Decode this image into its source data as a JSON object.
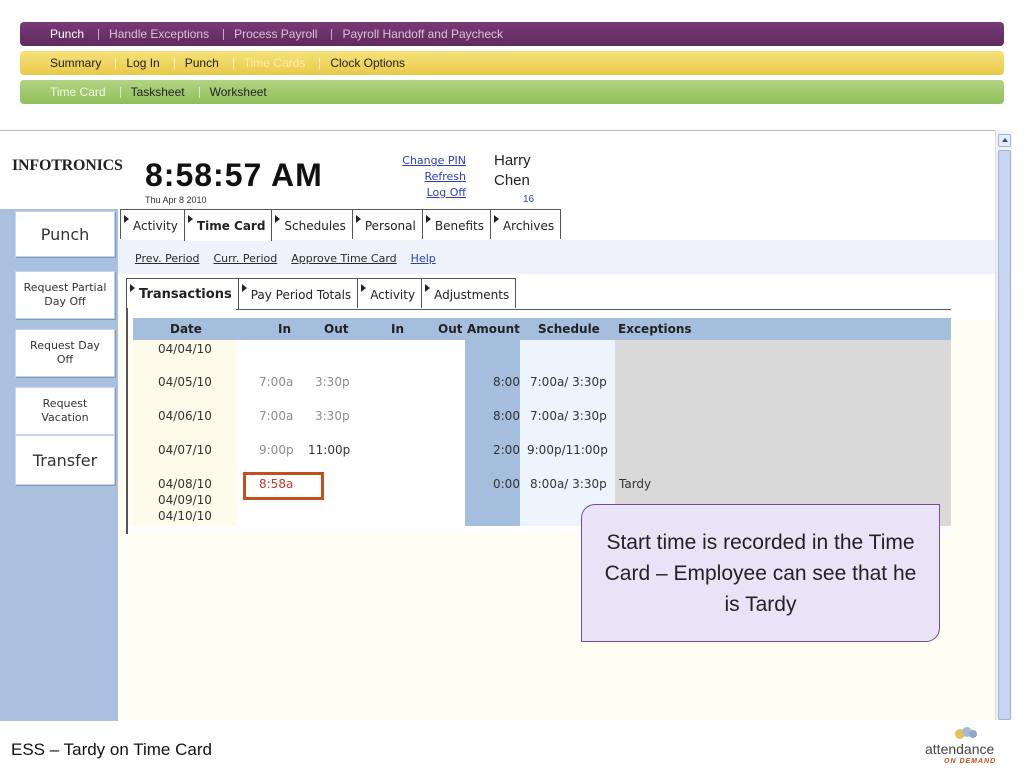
{
  "nav": {
    "level1": [
      {
        "label": "Punch",
        "active": true
      },
      {
        "label": "Handle Exceptions",
        "active": false
      },
      {
        "label": "Process Payroll",
        "active": false
      },
      {
        "label": "Payroll Handoff and Paycheck",
        "active": false
      }
    ],
    "level2": [
      {
        "label": "Summary",
        "active": false
      },
      {
        "label": "Log In",
        "active": false
      },
      {
        "label": "Punch",
        "active": false
      },
      {
        "label": "Time Cards",
        "active": true
      },
      {
        "label": "Clock Options",
        "active": false
      }
    ],
    "level3": [
      {
        "label": "Time Card",
        "active": true
      },
      {
        "label": "Tasksheet",
        "active": false
      },
      {
        "label": "Worksheet",
        "active": false
      }
    ]
  },
  "header": {
    "logo": "INFOTRONICS",
    "clock": "8:58:57 AM",
    "date": "Thu Apr 8 2010",
    "links": [
      "Change PIN",
      "Refresh",
      "Log Off"
    ],
    "user_first": "Harry",
    "user_last": "Chen",
    "user_id": "16"
  },
  "sidebar": {
    "buttons": [
      "Punch",
      "Request Partial Day Off",
      "Request Day Off",
      "Request Vacation",
      "Transfer"
    ]
  },
  "main_tabs": [
    {
      "label": "Activity",
      "active": false
    },
    {
      "label": "Time Card",
      "active": true
    },
    {
      "label": "Schedules",
      "active": false
    },
    {
      "label": "Personal",
      "active": false
    },
    {
      "label": "Benefits",
      "active": false
    },
    {
      "label": "Archives",
      "active": false
    }
  ],
  "period_links": [
    "Prev. Period",
    "Curr. Period",
    "Approve Time Card",
    "Help"
  ],
  "sub_tabs": [
    {
      "label": "Transactions",
      "active": true
    },
    {
      "label": "Pay Period Totals",
      "active": false
    },
    {
      "label": "Activity",
      "active": false
    },
    {
      "label": "Adjustments",
      "active": false
    }
  ],
  "table": {
    "headers": [
      "Date",
      "In",
      "Out",
      "In",
      "Out",
      "Amount",
      "Schedule",
      "Exceptions"
    ],
    "rows": [
      {
        "date": "04/04/10",
        "in1": "",
        "out1": "",
        "in2": "",
        "out2": "",
        "amount": "",
        "schedule": "",
        "exceptions": ""
      },
      {
        "date": "04/05/10",
        "in1": "7:00a",
        "out1": "3:30p",
        "in2": "",
        "out2": "",
        "amount": "8:00",
        "schedule": "7:00a/ 3:30p",
        "exceptions": ""
      },
      {
        "date": "04/06/10",
        "in1": "7:00a",
        "out1": "3:30p",
        "in2": "",
        "out2": "",
        "amount": "8:00",
        "schedule": "7:00a/ 3:30p",
        "exceptions": ""
      },
      {
        "date": "04/07/10",
        "in1": "9:00p",
        "out1": "11:00p",
        "in2": "",
        "out2": "",
        "amount": "2:00",
        "schedule": "9:00p/11:00p",
        "exceptions": ""
      },
      {
        "date": "04/08/10",
        "in1": "8:58a",
        "out1": "",
        "in2": "",
        "out2": "",
        "amount": "0:00",
        "schedule": "8:00a/ 3:30p",
        "exceptions": "Tardy"
      },
      {
        "date": "04/09/10",
        "in1": "",
        "out1": "",
        "in2": "",
        "out2": "",
        "amount": "",
        "schedule": "",
        "exceptions": ""
      },
      {
        "date": "04/10/10",
        "in1": "",
        "out1": "",
        "in2": "",
        "out2": "",
        "amount": "",
        "schedule": "",
        "exceptions": ""
      }
    ]
  },
  "callout": "Start time is recorded in the Time Card – Employee can see that he is Tardy",
  "footer": {
    "title": "ESS – Tardy on Time Card",
    "brand": "attendance",
    "brand_sub": "ON DEMAND"
  },
  "colors": {
    "nav1": "#6b3169",
    "nav2": "#f0d45e",
    "nav3": "#a0c96e",
    "sidebar": "#a9c1df",
    "grid_header": "#a6bede",
    "highlight": "#c0501e",
    "link": "#2d40b8"
  }
}
